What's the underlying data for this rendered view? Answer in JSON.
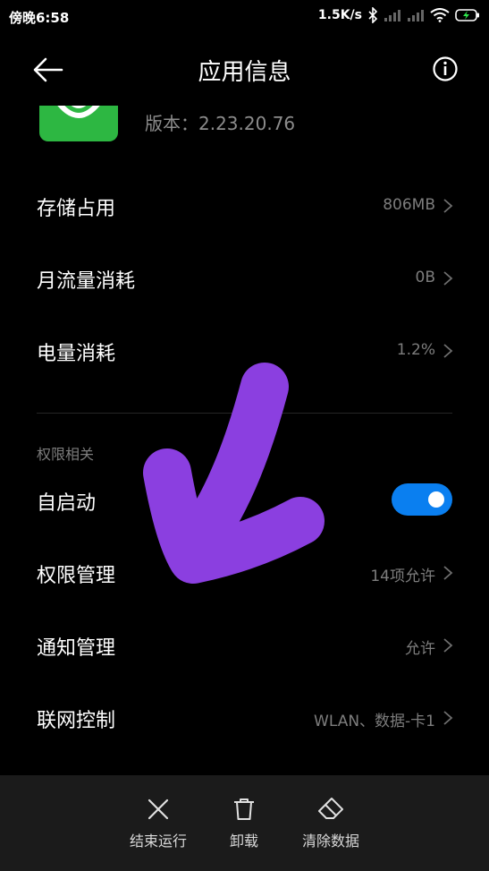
{
  "status": {
    "time": "傍晚6:58",
    "speed": "1.5K/s"
  },
  "header": {
    "title": "应用信息"
  },
  "app": {
    "version": "版本：2.23.20.76"
  },
  "rows": [
    {
      "label": "存储占用",
      "value": "806MB"
    },
    {
      "label": "月流量消耗",
      "value": "0B"
    },
    {
      "label": "电量消耗",
      "value": "1.2%"
    }
  ],
  "permissions": {
    "section_title": "权限相关",
    "autostart": {
      "label": "自启动",
      "enabled": true
    },
    "items": [
      {
        "label": "权限管理",
        "value": "14项允许"
      },
      {
        "label": "通知管理",
        "value": "允许"
      },
      {
        "label": "联网控制",
        "value": "WLAN、数据-卡1"
      }
    ]
  },
  "actions": [
    {
      "label": "结束运行",
      "icon": "close-icon"
    },
    {
      "label": "卸载",
      "icon": "trash-icon"
    },
    {
      "label": "清除数据",
      "icon": "eraser-icon"
    }
  ],
  "colors": {
    "toggle_on": "#0a7ff0",
    "annotation_arrow": "#8b3fe0",
    "app_icon": "#2db742"
  }
}
